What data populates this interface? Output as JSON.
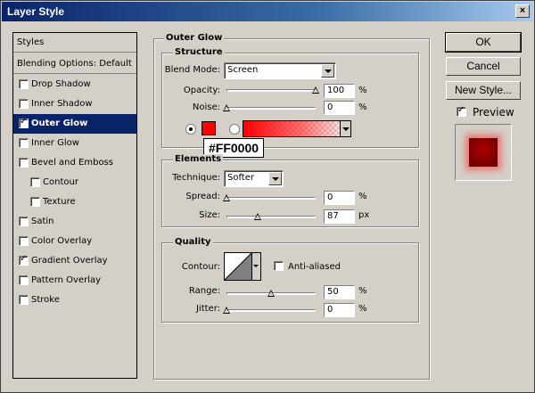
{
  "window": {
    "title": "Layer Style",
    "close_glyph": "×"
  },
  "left_panel": {
    "header": "Styles",
    "blending": "Blending Options: Default",
    "styles": [
      {
        "label": "Drop Shadow",
        "checked": false,
        "selected": false,
        "indent": false
      },
      {
        "label": "Inner Shadow",
        "checked": false,
        "selected": false,
        "indent": false
      },
      {
        "label": "Outer Glow",
        "checked": true,
        "selected": true,
        "indent": false
      },
      {
        "label": "Inner Glow",
        "checked": false,
        "selected": false,
        "indent": false
      },
      {
        "label": "Bevel and Emboss",
        "checked": false,
        "selected": false,
        "indent": false
      },
      {
        "label": "Contour",
        "checked": false,
        "selected": false,
        "indent": true
      },
      {
        "label": "Texture",
        "checked": false,
        "selected": false,
        "indent": true
      },
      {
        "label": "Satin",
        "checked": false,
        "selected": false,
        "indent": false
      },
      {
        "label": "Color Overlay",
        "checked": false,
        "selected": false,
        "indent": false
      },
      {
        "label": "Gradient Overlay",
        "checked": true,
        "selected": false,
        "indent": false
      },
      {
        "label": "Pattern Overlay",
        "checked": false,
        "selected": false,
        "indent": false
      },
      {
        "label": "Stroke",
        "checked": false,
        "selected": false,
        "indent": false
      }
    ]
  },
  "outer_glow": {
    "title": "Outer Glow",
    "structure": {
      "title": "Structure",
      "blend_mode_label": "Blend Mode:",
      "blend_mode": "Screen",
      "opacity_label": "Opacity:",
      "opacity": "100",
      "opacity_level": 1.0,
      "noise_label": "Noise:",
      "noise": "0",
      "noise_level": 0,
      "percent": "%",
      "color_hex": "#FF0000",
      "color_tooltip": "#FF0000",
      "swatch_color": "#ff0000"
    },
    "elements": {
      "title": "Elements",
      "technique_label": "Technique:",
      "technique": "Softer",
      "spread_label": "Spread:",
      "spread": "0",
      "spread_level": 0,
      "size_label": "Size:",
      "size": "87",
      "size_level": 0.35,
      "percent": "%",
      "px": "px"
    },
    "quality": {
      "title": "Quality",
      "contour_label": "Contour:",
      "anti_aliased_label": "Anti-aliased",
      "range_label": "Range:",
      "range": "50",
      "range_level": 0.5,
      "jitter_label": "Jitter:",
      "jitter": "0",
      "jitter_level": 0,
      "percent": "%"
    }
  },
  "buttons": {
    "ok": "OK",
    "cancel": "Cancel",
    "new_style": "New Style...",
    "preview_label": "Preview",
    "preview_checked": true
  }
}
